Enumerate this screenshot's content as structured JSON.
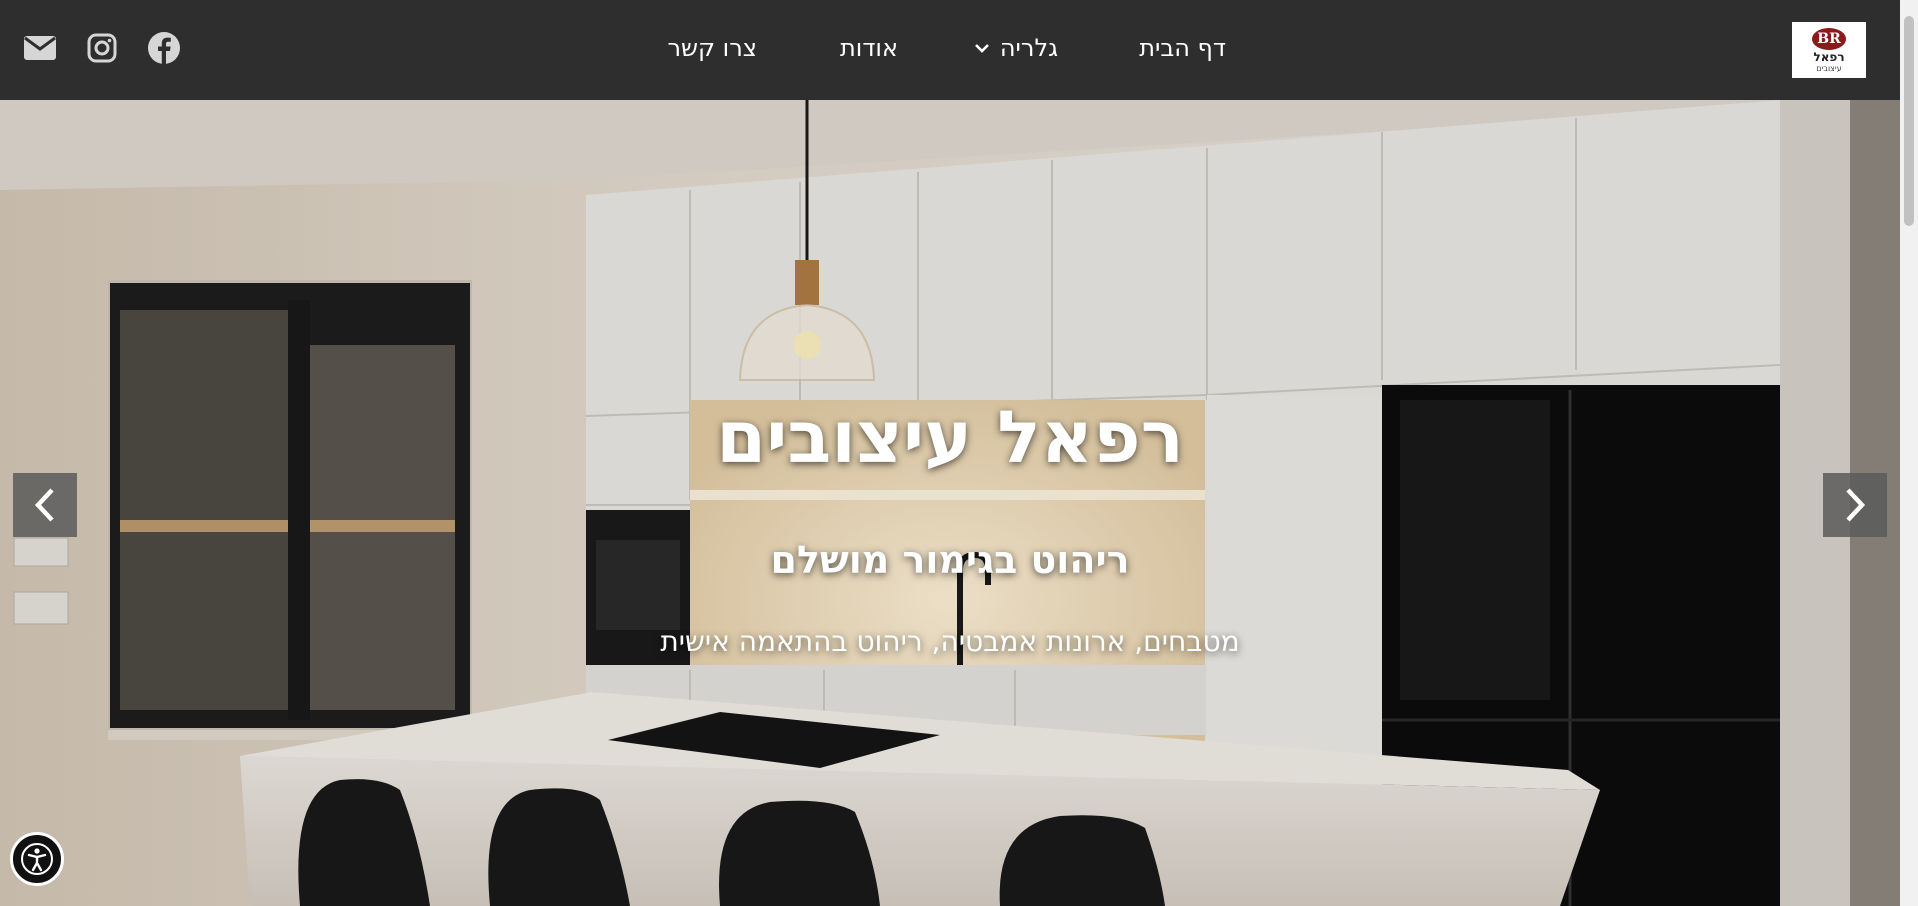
{
  "header": {
    "logo": {
      "mark": "BR",
      "name": "רפאל",
      "tagline": "עיצובים"
    },
    "nav": [
      {
        "label": "דף הבית"
      },
      {
        "label": "גלריה",
        "has_dropdown": true
      },
      {
        "label": "אודות"
      },
      {
        "label": "צרו קשר"
      }
    ],
    "social_icons": [
      "facebook-icon",
      "instagram-icon",
      "mail-icon"
    ]
  },
  "hero": {
    "title": "רפאל עיצובים",
    "subtitle": "ריהוט בגימור מושלם",
    "description": "מטבחים, ארונות אמבטיה, ריהוט בהתאמה אישית",
    "prev_icon": "chevron-left-icon",
    "next_icon": "chevron-right-icon"
  },
  "accessibility": {
    "icon": "accessibility-icon"
  },
  "colors": {
    "header_bg": "#2e2e2e",
    "text": "#ffffff",
    "arrow_bg": "#5a5a5a"
  }
}
